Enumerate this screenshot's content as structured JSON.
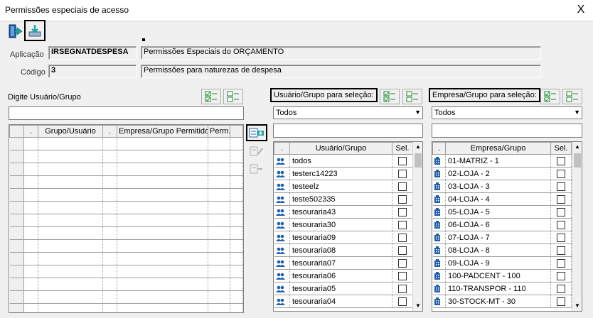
{
  "window": {
    "title": "Permissões especiais de acesso",
    "close_label": "X"
  },
  "toolbar": {
    "exit_icon": "exit-door-icon",
    "save_icon": "save-download-icon"
  },
  "header": {
    "aplicacao_label": "Aplicação",
    "aplicacao_code": "IRSEGNATDESPESA",
    "aplicacao_desc": "Permissões Especiais do ORÇAMENTO",
    "codigo_label": "Código",
    "codigo_value": "3",
    "codigo_desc": "Permissões para naturezas de despesa"
  },
  "left": {
    "label": "Digite Usuário/Grupo",
    "input_value": "",
    "columns": [
      ".",
      "Grupo/Usuário",
      ".",
      "Empresa/Grupo Permitido",
      "Perm."
    ],
    "empty_rows": 14
  },
  "users": {
    "label": "Usuário/Grupo para seleção:",
    "combo_value": "Todos",
    "filter_value": "",
    "columns": [
      ".",
      "Usuário/Grupo",
      "Sel."
    ],
    "rows": [
      "todos",
      "testerc14223",
      "testeelz",
      "teste502335",
      "tesouraria43",
      "tesouraria30",
      "tesouraria09",
      "tesouraria08",
      "tesouraria07",
      "tesouraria06",
      "tesouraria05",
      "tesouraria04"
    ]
  },
  "companies": {
    "label": "Empresa/Grupo para seleção:",
    "combo_value": "Todos",
    "filter_value": "",
    "columns": [
      ".",
      "Empresa/Grupo",
      "Sel."
    ],
    "rows": [
      "01-MATRIZ - 1",
      "02-LOJA - 2",
      "03-LOJA - 3",
      "04-LOJA - 4",
      "05-LOJA - 5",
      "06-LOJA - 6",
      "07-LOJA - 7",
      "08-LOJA - 8",
      "09-LOJA - 9",
      "100-PADCENT - 100",
      "110-TRANSPOR - 110",
      "30-STOCK-MT - 30"
    ]
  },
  "colors": {
    "icon_teal": "#1ba5a5",
    "icon_blue": "#2060b0",
    "icon_green": "#1a8a2a"
  }
}
